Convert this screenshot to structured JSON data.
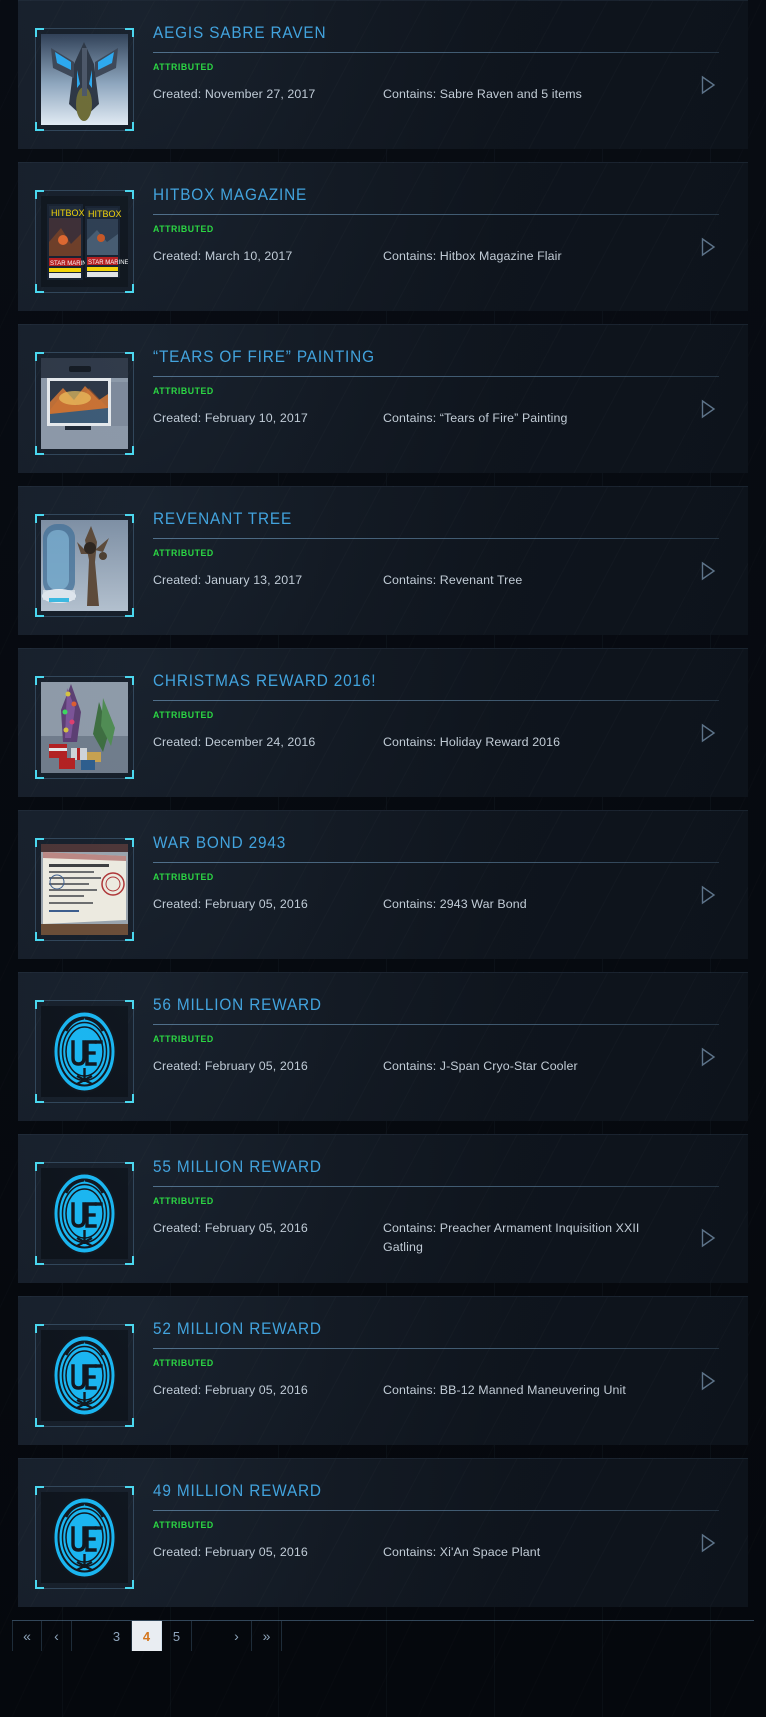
{
  "page": {
    "status_label": "ATTRIBUTED",
    "created_prefix": "Created: ",
    "contains_prefix": "Contains: ",
    "status_color": "#27d83c",
    "title_color": "#3fa2dd",
    "accent_color": "#48d8ef",
    "active_page_color": "#d4761e"
  },
  "items": [
    {
      "title": "AEGIS SABRE RAVEN",
      "status": "ATTRIBUTED",
      "created": "Created: November 27, 2017",
      "contains": "Contains: Sabre Raven and 5 items",
      "thumb": "sabre-raven-ship-thumbnail"
    },
    {
      "title": "HITBOX MAGAZINE",
      "status": "ATTRIBUTED",
      "created": "Created: March 10, 2017",
      "contains": "Contains: Hitbox Magazine Flair",
      "thumb": "hitbox-magazine-thumbnail"
    },
    {
      "title": "“TEARS OF FIRE” PAINTING",
      "status": "ATTRIBUTED",
      "created": "Created: February 10, 2017",
      "contains": "Contains: “Tears of Fire” Painting",
      "thumb": "tears-of-fire-painting-thumbnail"
    },
    {
      "title": "REVENANT TREE",
      "status": "ATTRIBUTED",
      "created": "Created: January 13, 2017",
      "contains": "Contains: Revenant Tree",
      "thumb": "revenant-tree-thumbnail"
    },
    {
      "title": "CHRISTMAS REWARD 2016!",
      "status": "ATTRIBUTED",
      "created": "Created: December 24, 2016",
      "contains": "Contains: Holiday Reward 2016",
      "thumb": "christmas-reward-thumbnail"
    },
    {
      "title": "WAR BOND 2943",
      "status": "ATTRIBUTED",
      "created": "Created: February 05, 2016",
      "contains": "Contains: 2943 War Bond",
      "thumb": "war-bond-certificate-thumbnail"
    },
    {
      "title": "56 MILLION REWARD",
      "status": "ATTRIBUTED",
      "created": "Created: February 05, 2016",
      "contains": "Contains: J-Span Cryo-Star Cooler",
      "thumb": "uee-logo-thumbnail"
    },
    {
      "title": "55 MILLION REWARD",
      "status": "ATTRIBUTED",
      "created": "Created: February 05, 2016",
      "contains": "Contains: Preacher Armament Inquisition XXII Gatling",
      "thumb": "uee-logo-thumbnail"
    },
    {
      "title": "52 MILLION REWARD",
      "status": "ATTRIBUTED",
      "created": "Created: February 05, 2016",
      "contains": "Contains: BB-12 Manned Maneuvering Unit",
      "thumb": "uee-logo-thumbnail"
    },
    {
      "title": "49 MILLION REWARD",
      "status": "ATTRIBUTED",
      "created": "Created: February 05, 2016",
      "contains": "Contains: Xi'An Space Plant",
      "thumb": "uee-logo-thumbnail"
    }
  ],
  "pagination": {
    "first_label": "«",
    "prev_label": "‹",
    "next_label": "›",
    "last_label": "»",
    "pages": [
      "3",
      "4",
      "5"
    ],
    "current_page": "4"
  }
}
